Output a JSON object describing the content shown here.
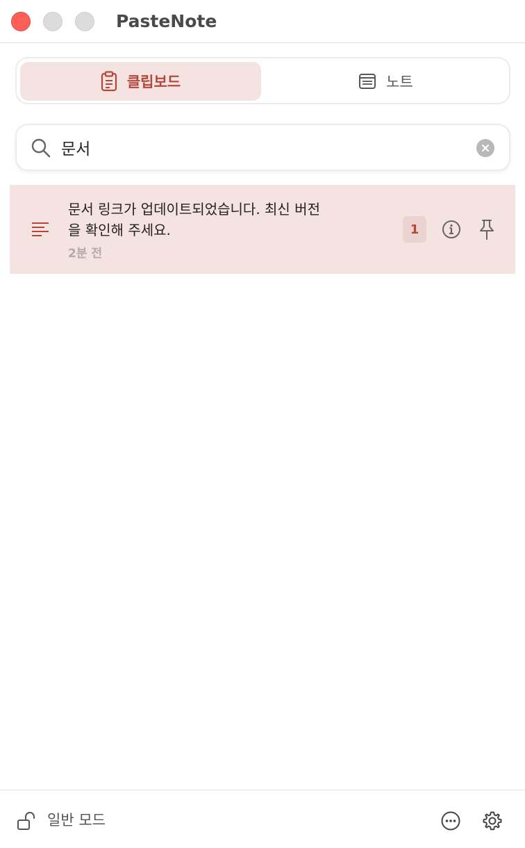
{
  "window": {
    "title": "PasteNote"
  },
  "tabs": [
    {
      "label": "클립보드",
      "icon": "clipboard-icon",
      "selected": true
    },
    {
      "label": "노트",
      "icon": "note-icon",
      "selected": false
    }
  ],
  "search": {
    "value": "문서",
    "placeholder": ""
  },
  "items": [
    {
      "type_icon": "text-lines-icon",
      "text": "문서 링크가 업데이트되었습니다. 최신 버전을 확인해 주세요.",
      "time": "2분 전",
      "count": "1"
    }
  ],
  "footer": {
    "mode_label": "일반 모드",
    "lock_icon": "unlock-icon"
  },
  "colors": {
    "accent": "#b4473b",
    "selected_bg": "#f5e3e1",
    "close": "#fe5f57"
  }
}
